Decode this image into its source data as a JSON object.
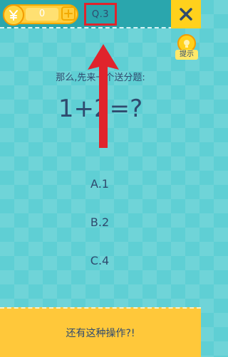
{
  "header": {
    "coins": "0",
    "add_symbol": "+",
    "question_number": "Q.3",
    "close_symbol": "X"
  },
  "hint": {
    "label": "提示"
  },
  "question": {
    "prompt": "那么,先来一个送分题:",
    "equation": "1+2=?"
  },
  "options": [
    {
      "label": "A.1"
    },
    {
      "label": "B.2"
    },
    {
      "label": "C.4"
    }
  ],
  "footer": {
    "text": "还有这种操作?!"
  },
  "colors": {
    "background": "#5fcfd4",
    "header": "#2aa6ad",
    "accent_yellow": "#ffd11c",
    "highlight_red": "#e0242c",
    "text": "#2f4a6e"
  }
}
